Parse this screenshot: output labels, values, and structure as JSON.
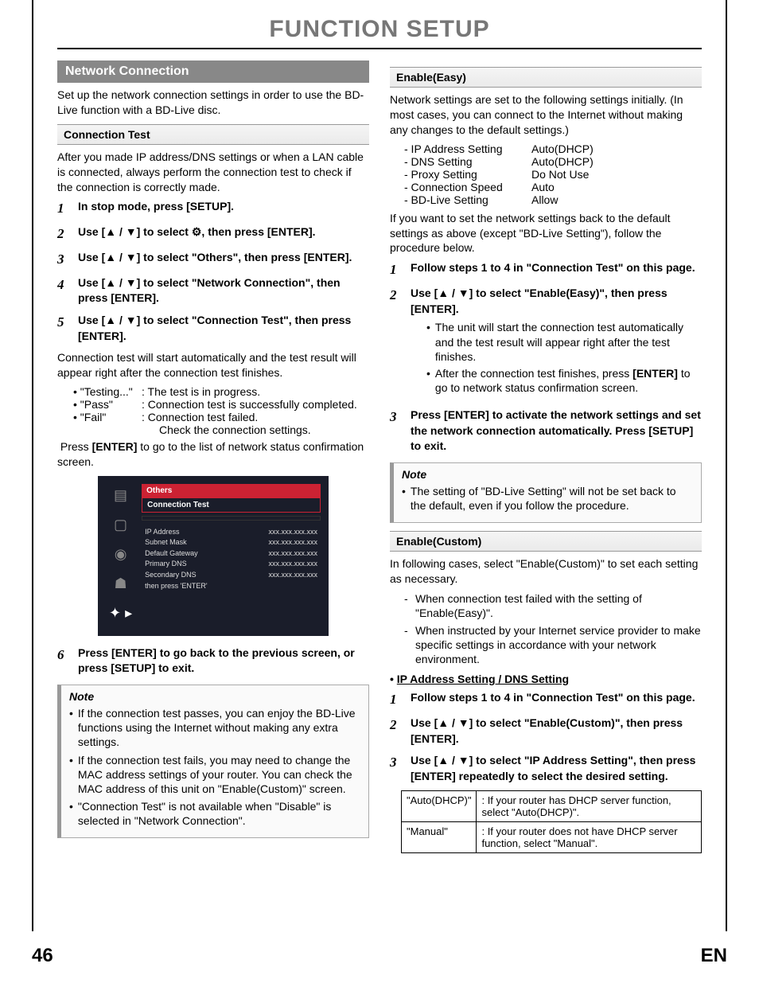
{
  "page_title": "FUNCTION SETUP",
  "page_number": "46",
  "lang": "EN",
  "left": {
    "section": "Network Connection",
    "intro": "Set up the network connection settings in order to use the BD-Live function with a BD-Live disc.",
    "connection_test_head": "Connection Test",
    "connection_test_intro": "After you made IP address/DNS settings or when a LAN cable is connected, always perform the connection test to check if the connection is correctly made.",
    "steps": [
      "In stop mode, press [SETUP].",
      "Use [▲ / ▼] to select ⚙, then press [ENTER].",
      "Use [▲ / ▼] to select \"Others\", then press [ENTER].",
      "Use [▲ / ▼] to select \"Network Connection\", then press [ENTER].",
      "Use [▲ / ▼] to select \"Connection Test\", then press [ENTER]."
    ],
    "after_steps": "Connection test will start automatically and the test result will appear right after the connection test finishes.",
    "results": [
      {
        "lbl": "• \"Testing...\"",
        "desc": ": The test is in progress."
      },
      {
        "lbl": "• \"Pass\"",
        "desc": ": Connection test is successfully completed."
      },
      {
        "lbl": "• \"Fail\"",
        "desc": ": Connection test failed."
      }
    ],
    "results_extra": "Check the connection settings.",
    "press_enter": "Press [ENTER] to go to the list of network status confirmation screen.",
    "osd": {
      "head": "Others",
      "sub": "Connection Test",
      "rows": [
        {
          "k": "IP Address",
          "v": "xxx.xxx.xxx.xxx"
        },
        {
          "k": "Subnet Mask",
          "v": "xxx.xxx.xxx.xxx"
        },
        {
          "k": "Default Gateway",
          "v": "xxx.xxx.xxx.xxx"
        },
        {
          "k": "Primary DNS",
          "v": "xxx.xxx.xxx.xxx"
        },
        {
          "k": "Secondary DNS",
          "v": "xxx.xxx.xxx.xxx"
        }
      ],
      "note": "then press 'ENTER'"
    },
    "step6": "Press [ENTER] to go back to the previous screen, or press [SETUP] to exit.",
    "note_title": "Note",
    "notes": [
      "If the connection test passes, you can enjoy the BD-Live functions using the Internet without making any extra settings.",
      "If the connection test fails, you may need to change the MAC address settings of your router. You can check the MAC address of this unit on \"Enable(Custom)\" screen.",
      "\"Connection Test\" is not available when \"Disable\" is selected in \"Network Connection\"."
    ]
  },
  "right": {
    "enable_easy_head": "Enable(Easy)",
    "enable_easy_intro": "Network settings are set to the following settings initially. (In most cases, you can connect to the Internet without making any changes to the default settings.)",
    "settings": [
      {
        "k": "- IP Address Setting",
        "v": "Auto(DHCP)"
      },
      {
        "k": "- DNS Setting",
        "v": "Auto(DHCP)"
      },
      {
        "k": "- Proxy Setting",
        "v": "Do Not Use"
      },
      {
        "k": "- Connection Speed",
        "v": "Auto"
      },
      {
        "k": "- BD-Live Setting",
        "v": "Allow"
      }
    ],
    "enable_easy_reset": "If you want to set the network settings back to the default settings as above (except \"BD-Live Setting\"), follow the procedure below.",
    "easy_steps": [
      "Follow steps 1 to 4 in \"Connection Test\" on this page.",
      "Use [▲ / ▼] to select \"Enable(Easy)\", then press [ENTER].",
      "Press [ENTER] to activate the network settings and set the network connection automatically. Press [SETUP] to exit."
    ],
    "easy_sub": [
      "The unit will start the connection test automatically and the test result will appear right after the test finishes.",
      "After the connection test finishes, press [ENTER] to go to network status confirmation screen."
    ],
    "note_title": "Note",
    "easy_note": "The setting of \"BD-Live Setting\" will not be set back to the default, even if you follow the procedure.",
    "enable_custom_head": "Enable(Custom)",
    "enable_custom_intro": "In following cases, select \"Enable(Custom)\" to set each setting as necessary.",
    "custom_cases": [
      "When connection test failed with the setting of \"Enable(Easy)\".",
      "When instructed by your Internet service provider to make specific settings in accordance with your network environment."
    ],
    "ip_dns_head": "IP Address Setting / DNS Setting",
    "custom_steps": [
      "Follow steps 1 to 4 in \"Connection Test\" on this page.",
      "Use [▲ / ▼] to select \"Enable(Custom)\", then press [ENTER].",
      "Use [▲ / ▼] to select \"IP Address Setting\", then press [ENTER] repeatedly to select the desired setting."
    ],
    "opts": [
      {
        "k": "\"Auto(DHCP)\"",
        "v": ": If your router has DHCP server function, select \"Auto(DHCP)\"."
      },
      {
        "k": "\"Manual\"",
        "v": ": If your router does not have DHCP server function, select \"Manual\"."
      }
    ]
  }
}
